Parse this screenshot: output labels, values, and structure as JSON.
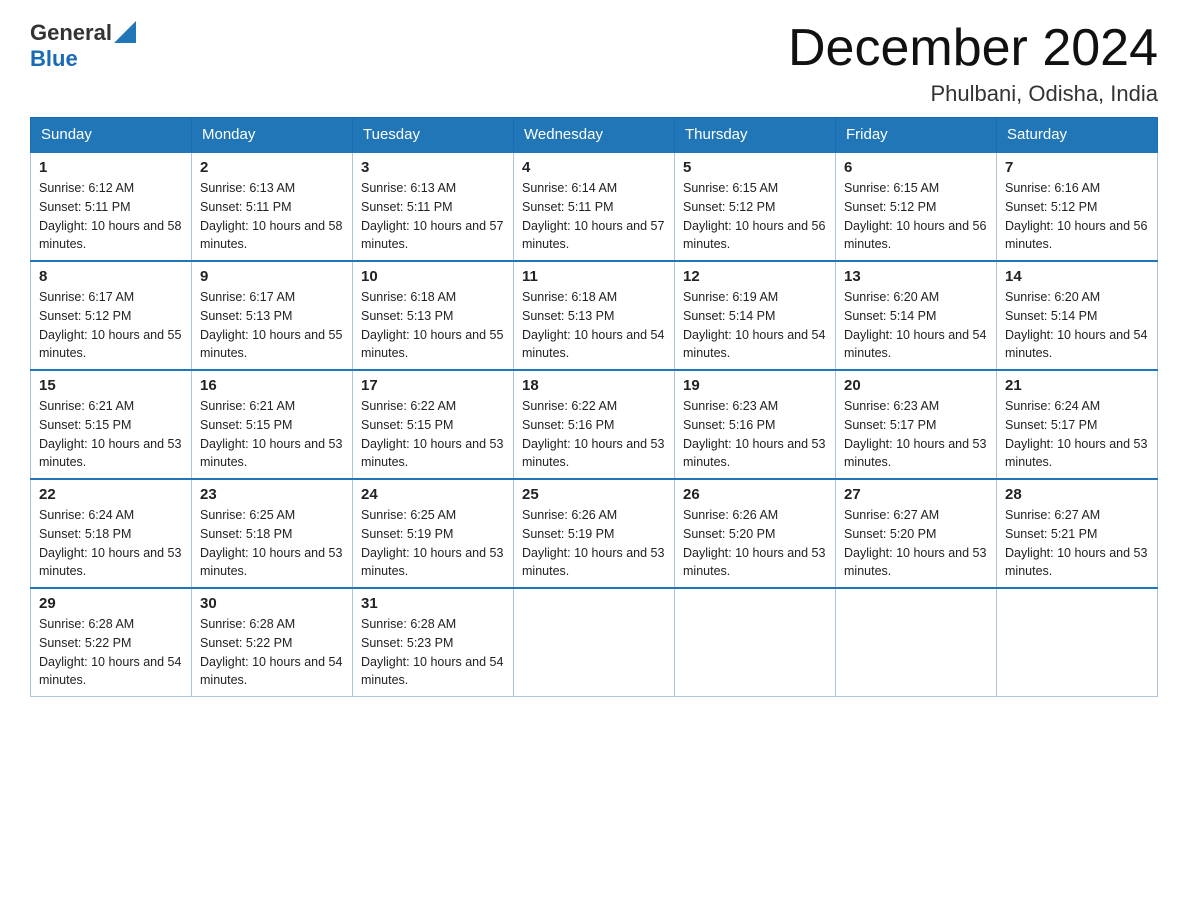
{
  "header": {
    "logo_general": "General",
    "logo_blue": "Blue",
    "month_title": "December 2024",
    "location": "Phulbani, Odisha, India"
  },
  "weekdays": [
    "Sunday",
    "Monday",
    "Tuesday",
    "Wednesday",
    "Thursday",
    "Friday",
    "Saturday"
  ],
  "weeks": [
    [
      {
        "day": "1",
        "sunrise": "6:12 AM",
        "sunset": "5:11 PM",
        "daylight": "10 hours and 58 minutes."
      },
      {
        "day": "2",
        "sunrise": "6:13 AM",
        "sunset": "5:11 PM",
        "daylight": "10 hours and 58 minutes."
      },
      {
        "day": "3",
        "sunrise": "6:13 AM",
        "sunset": "5:11 PM",
        "daylight": "10 hours and 57 minutes."
      },
      {
        "day": "4",
        "sunrise": "6:14 AM",
        "sunset": "5:11 PM",
        "daylight": "10 hours and 57 minutes."
      },
      {
        "day": "5",
        "sunrise": "6:15 AM",
        "sunset": "5:12 PM",
        "daylight": "10 hours and 56 minutes."
      },
      {
        "day": "6",
        "sunrise": "6:15 AM",
        "sunset": "5:12 PM",
        "daylight": "10 hours and 56 minutes."
      },
      {
        "day": "7",
        "sunrise": "6:16 AM",
        "sunset": "5:12 PM",
        "daylight": "10 hours and 56 minutes."
      }
    ],
    [
      {
        "day": "8",
        "sunrise": "6:17 AM",
        "sunset": "5:12 PM",
        "daylight": "10 hours and 55 minutes."
      },
      {
        "day": "9",
        "sunrise": "6:17 AM",
        "sunset": "5:13 PM",
        "daylight": "10 hours and 55 minutes."
      },
      {
        "day": "10",
        "sunrise": "6:18 AM",
        "sunset": "5:13 PM",
        "daylight": "10 hours and 55 minutes."
      },
      {
        "day": "11",
        "sunrise": "6:18 AM",
        "sunset": "5:13 PM",
        "daylight": "10 hours and 54 minutes."
      },
      {
        "day": "12",
        "sunrise": "6:19 AM",
        "sunset": "5:14 PM",
        "daylight": "10 hours and 54 minutes."
      },
      {
        "day": "13",
        "sunrise": "6:20 AM",
        "sunset": "5:14 PM",
        "daylight": "10 hours and 54 minutes."
      },
      {
        "day": "14",
        "sunrise": "6:20 AM",
        "sunset": "5:14 PM",
        "daylight": "10 hours and 54 minutes."
      }
    ],
    [
      {
        "day": "15",
        "sunrise": "6:21 AM",
        "sunset": "5:15 PM",
        "daylight": "10 hours and 53 minutes."
      },
      {
        "day": "16",
        "sunrise": "6:21 AM",
        "sunset": "5:15 PM",
        "daylight": "10 hours and 53 minutes."
      },
      {
        "day": "17",
        "sunrise": "6:22 AM",
        "sunset": "5:15 PM",
        "daylight": "10 hours and 53 minutes."
      },
      {
        "day": "18",
        "sunrise": "6:22 AM",
        "sunset": "5:16 PM",
        "daylight": "10 hours and 53 minutes."
      },
      {
        "day": "19",
        "sunrise": "6:23 AM",
        "sunset": "5:16 PM",
        "daylight": "10 hours and 53 minutes."
      },
      {
        "day": "20",
        "sunrise": "6:23 AM",
        "sunset": "5:17 PM",
        "daylight": "10 hours and 53 minutes."
      },
      {
        "day": "21",
        "sunrise": "6:24 AM",
        "sunset": "5:17 PM",
        "daylight": "10 hours and 53 minutes."
      }
    ],
    [
      {
        "day": "22",
        "sunrise": "6:24 AM",
        "sunset": "5:18 PM",
        "daylight": "10 hours and 53 minutes."
      },
      {
        "day": "23",
        "sunrise": "6:25 AM",
        "sunset": "5:18 PM",
        "daylight": "10 hours and 53 minutes."
      },
      {
        "day": "24",
        "sunrise": "6:25 AM",
        "sunset": "5:19 PM",
        "daylight": "10 hours and 53 minutes."
      },
      {
        "day": "25",
        "sunrise": "6:26 AM",
        "sunset": "5:19 PM",
        "daylight": "10 hours and 53 minutes."
      },
      {
        "day": "26",
        "sunrise": "6:26 AM",
        "sunset": "5:20 PM",
        "daylight": "10 hours and 53 minutes."
      },
      {
        "day": "27",
        "sunrise": "6:27 AM",
        "sunset": "5:20 PM",
        "daylight": "10 hours and 53 minutes."
      },
      {
        "day": "28",
        "sunrise": "6:27 AM",
        "sunset": "5:21 PM",
        "daylight": "10 hours and 53 minutes."
      }
    ],
    [
      {
        "day": "29",
        "sunrise": "6:28 AM",
        "sunset": "5:22 PM",
        "daylight": "10 hours and 54 minutes."
      },
      {
        "day": "30",
        "sunrise": "6:28 AM",
        "sunset": "5:22 PM",
        "daylight": "10 hours and 54 minutes."
      },
      {
        "day": "31",
        "sunrise": "6:28 AM",
        "sunset": "5:23 PM",
        "daylight": "10 hours and 54 minutes."
      },
      null,
      null,
      null,
      null
    ]
  ]
}
